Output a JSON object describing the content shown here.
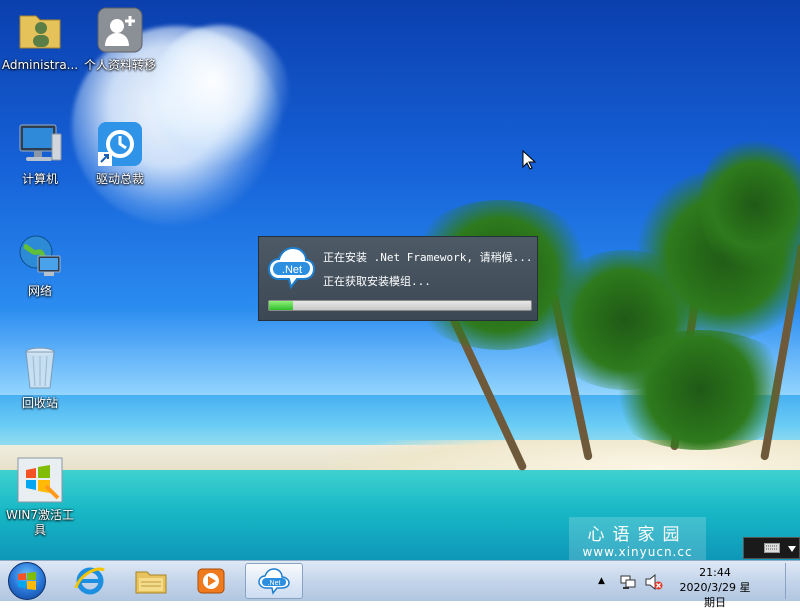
{
  "desktop_icons": [
    {
      "label": "Administra..."
    },
    {
      "label": "个人资料转移"
    },
    {
      "label": "计算机"
    },
    {
      "label": "驱动总裁"
    },
    {
      "label": "网络"
    },
    {
      "label": "回收站"
    },
    {
      "label": "WIN7激活工具"
    }
  ],
  "installer": {
    "line1": "正在安装 .Net Framework, 请稍候...",
    "line2": "正在获取安装模组...",
    "icon_text": ".Net",
    "progress": 0.09
  },
  "watermark": {
    "title": "心语家园",
    "url": "www.xinyucn.cc"
  },
  "taskbar": {
    "clock_time": "21:44",
    "clock_date": "2020/3/29 星期日",
    "tray_up_arrow": "▲",
    "active_app_icon_text": ".Net"
  },
  "colors": {
    "taskbar": "#c4d5ea",
    "installer_bg": "#3c4853",
    "progress_fill": "#2fbf2c"
  }
}
